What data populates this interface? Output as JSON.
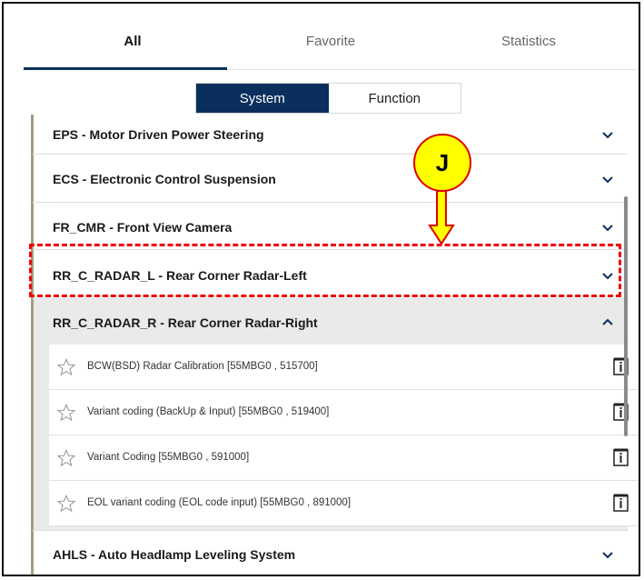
{
  "tabs": [
    {
      "label": "All"
    },
    {
      "label": "Favorite"
    },
    {
      "label": "Statistics"
    }
  ],
  "segmented": {
    "system": "System",
    "function": "Function"
  },
  "systems": [
    {
      "label": "EPS - Motor Driven Power Steering"
    },
    {
      "label": "ECS - Electronic Control Suspension"
    },
    {
      "label": "FR_CMR - Front View Camera"
    },
    {
      "label": "RR_C_RADAR_L - Rear Corner Radar-Left"
    },
    {
      "label": "RR_C_RADAR_R - Rear Corner Radar-Right"
    },
    {
      "label": "AHLS - Auto Headlamp Leveling System"
    }
  ],
  "functions": [
    {
      "label": "BCW(BSD) Radar Calibration [55MBG0 , 515700]"
    },
    {
      "label": "Variant coding (BackUp & Input) [55MBG0 , 519400]"
    },
    {
      "label": "Variant Coding [55MBG0 , 591000]"
    },
    {
      "label": "EOL variant coding (EOL code input) [55MBG0 , 891000]"
    }
  ],
  "callout": {
    "letter": "J"
  },
  "colors": {
    "accent": "#0a2f5c",
    "highlight": "#ee0000",
    "callout": "#ffff00",
    "sidebar_bar": "#a89a80"
  },
  "icons": {
    "chevron_down": "chevron-down-icon",
    "chevron_up": "chevron-up-icon",
    "star": "star-icon",
    "info": "info-icon"
  }
}
